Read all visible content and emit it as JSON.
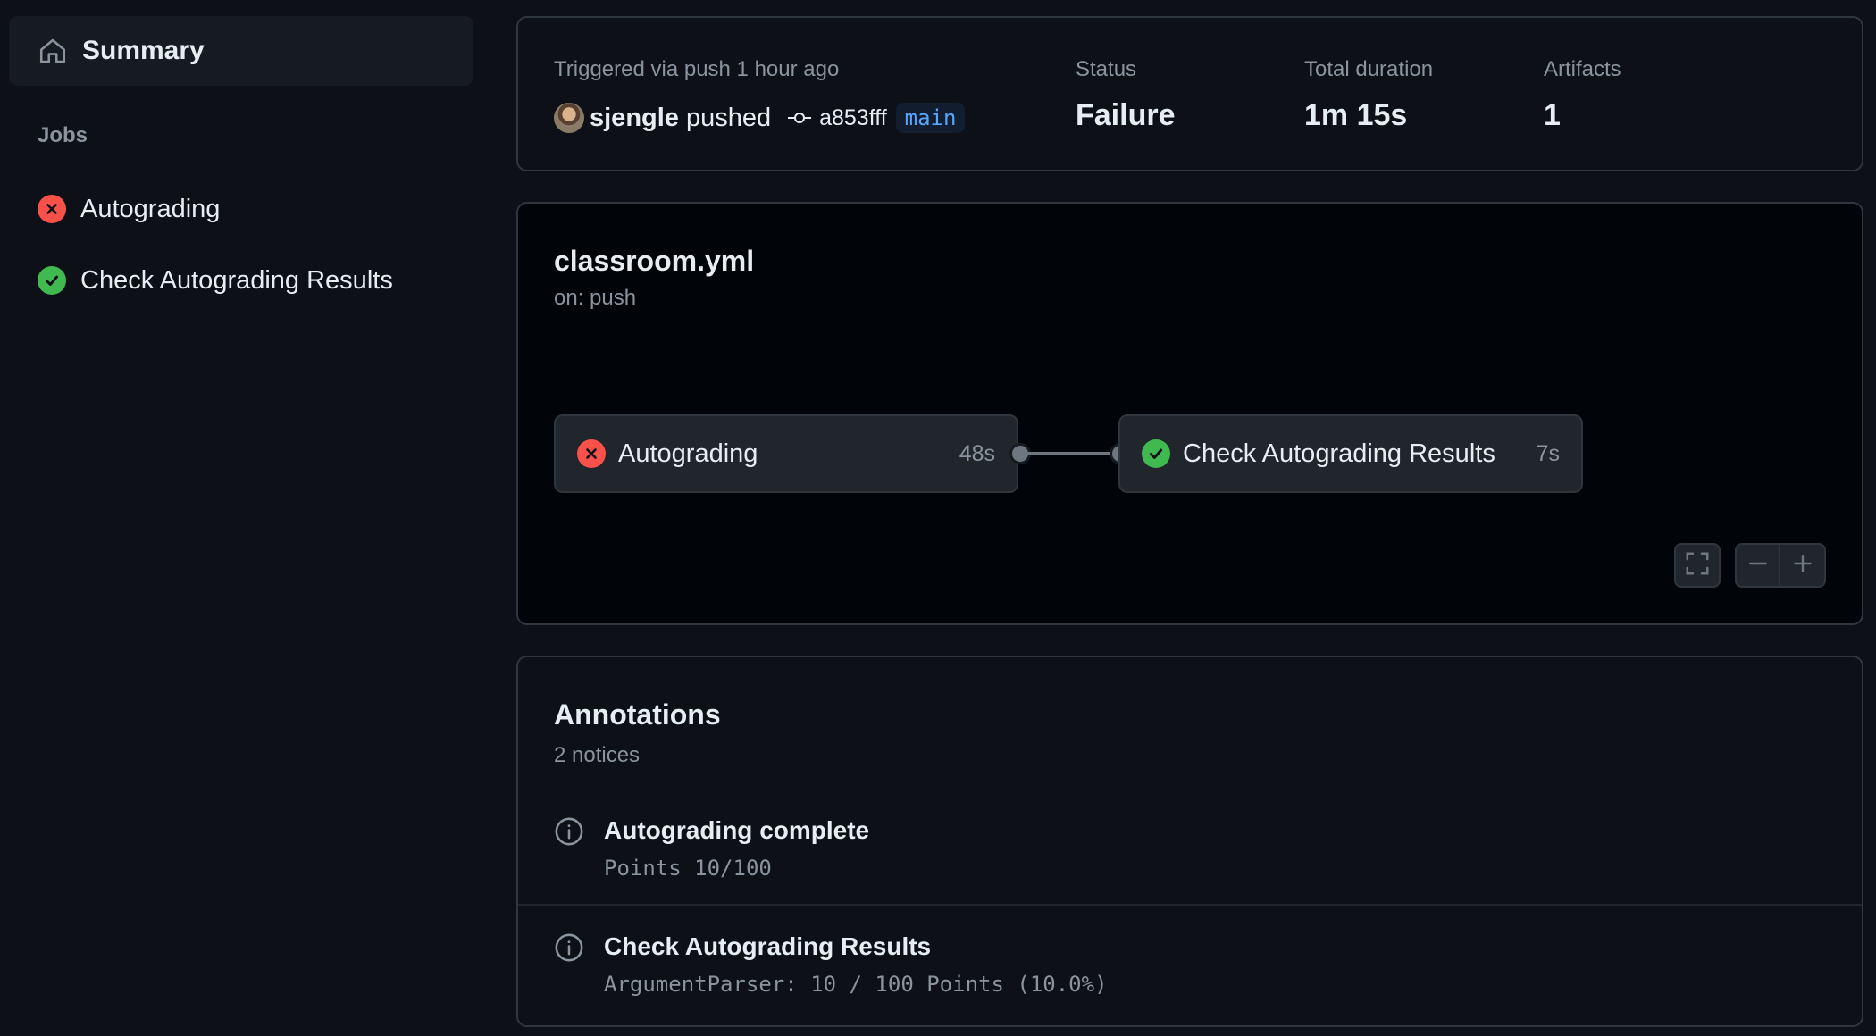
{
  "sidebar": {
    "summary_label": "Summary",
    "jobs_heading": "Jobs",
    "jobs": [
      {
        "label": "Autograding",
        "status": "failure"
      },
      {
        "label": "Check Autograding Results",
        "status": "success"
      }
    ]
  },
  "run": {
    "trigger_text": "Triggered via push 1 hour ago",
    "actor": "sjengle",
    "action": "pushed",
    "commit_sha": "a853fff",
    "branch": "main",
    "status_label": "Status",
    "status_value": "Failure",
    "duration_label": "Total duration",
    "duration_value": "1m 15s",
    "artifacts_label": "Artifacts",
    "artifacts_value": "1"
  },
  "workflow": {
    "file": "classroom.yml",
    "trigger": "on: push",
    "jobs": [
      {
        "label": "Autograding",
        "duration": "48s",
        "status": "failure"
      },
      {
        "label": "Check Autograding Results",
        "duration": "7s",
        "status": "success"
      }
    ]
  },
  "annotations": {
    "title": "Annotations",
    "count": "2 notices",
    "items": [
      {
        "title": "Autograding complete",
        "message": "Points 10/100"
      },
      {
        "title": "Check Autograding Results",
        "message": "ArgumentParser: 10 / 100 Points (10.0%)"
      }
    ]
  },
  "colors": {
    "background": "#0d1117",
    "failure": "#f85149",
    "success": "#3fb950",
    "branch_text": "#58a6ff"
  },
  "icons": [
    "home-icon",
    "x-circle-icon",
    "check-circle-icon",
    "commit-icon",
    "fullscreen-icon",
    "zoom-out-icon",
    "zoom-in-icon",
    "info-icon"
  ]
}
